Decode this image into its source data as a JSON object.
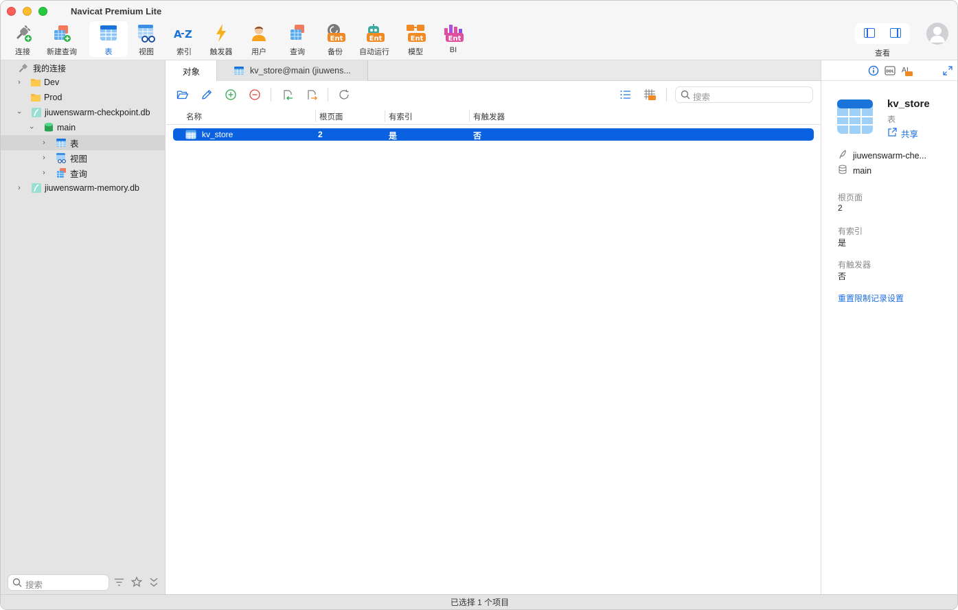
{
  "window": {
    "title": "Navicat Premium Lite"
  },
  "toolbar": {
    "buttons": [
      {
        "id": "connect",
        "label": "连接",
        "icon": "plug-icon"
      },
      {
        "id": "new-query",
        "label": "新建查询",
        "icon": "new-query-icon"
      },
      {
        "id": "table",
        "label": "表",
        "icon": "table-icon",
        "active": true
      },
      {
        "id": "view",
        "label": "视图",
        "icon": "view-icon"
      },
      {
        "id": "index",
        "label": "索引",
        "icon": "az-icon"
      },
      {
        "id": "trigger",
        "label": "触发器",
        "icon": "lightning-icon"
      },
      {
        "id": "user",
        "label": "用户",
        "icon": "user-icon"
      },
      {
        "id": "query",
        "label": "查询",
        "icon": "query-icon"
      },
      {
        "id": "backup",
        "label": "备份",
        "icon": "backup-icon",
        "badge": "Ent"
      },
      {
        "id": "automation",
        "label": "自动运行",
        "icon": "robot-icon",
        "badge": "Ent"
      },
      {
        "id": "model",
        "label": "模型",
        "icon": "model-icon",
        "badge": "Ent"
      },
      {
        "id": "bi",
        "label": "BI",
        "icon": "bi-icon",
        "badge": "Ent"
      }
    ],
    "view_label": "查看"
  },
  "sidebar": {
    "root_label": "我的连接",
    "items": [
      {
        "label": "Dev",
        "type": "folder"
      },
      {
        "label": "Prod",
        "type": "folder"
      },
      {
        "label": "jiuwenswarm-checkpoint.db",
        "type": "sqlite"
      },
      {
        "label": "main",
        "type": "schema"
      },
      {
        "label": "表",
        "type": "tables"
      },
      {
        "label": "视图",
        "type": "views"
      },
      {
        "label": "查询",
        "type": "queries"
      },
      {
        "label": "jiuwenswarm-memory.db",
        "type": "sqlite"
      }
    ],
    "search_placeholder": "搜索"
  },
  "tabs": [
    {
      "label": "对象"
    },
    {
      "label": "kv_store@main (jiuwens..."
    }
  ],
  "object_toolbar": {
    "search_placeholder": "搜索"
  },
  "table": {
    "columns": [
      "名称",
      "根页面",
      "有索引",
      "有触发器"
    ],
    "rows": [
      {
        "name": "kv_store",
        "root_page": "2",
        "has_index": "是",
        "has_trigger": "否"
      }
    ]
  },
  "inspector": {
    "name": "kv_store",
    "type": "表",
    "share_label": "共享",
    "database": "jiuwenswarm-che...",
    "schema": "main",
    "fields": [
      {
        "key": "根页面",
        "value": "2"
      },
      {
        "key": "有索引",
        "value": "是"
      },
      {
        "key": "有触发器",
        "value": "否"
      }
    ],
    "reset_link": "重置限制记录设置",
    "ent_badge": "Ent",
    "ddl_badge": "DDL"
  },
  "status": {
    "text": "已选择 1 个项目"
  },
  "colors": {
    "accent": "#1d6fe0",
    "selection": "#0a62e0",
    "ent_badge": "#f08a24"
  }
}
